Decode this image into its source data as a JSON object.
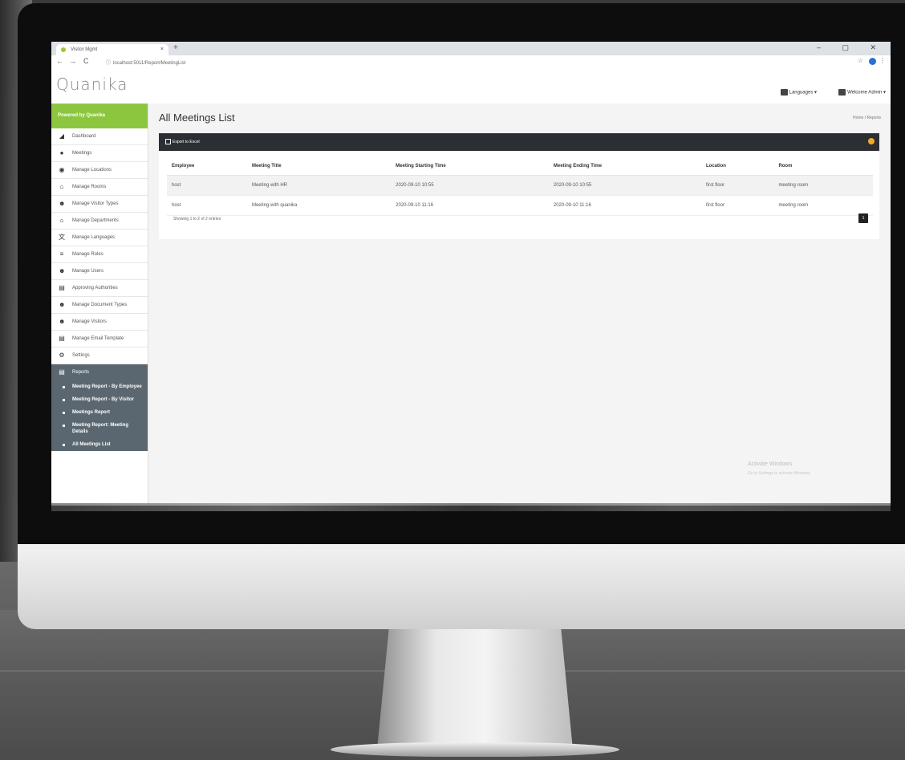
{
  "browser": {
    "tab_title": "Visitor Mgmt",
    "new_tab": "+",
    "close_tab": "×",
    "window_controls": "– ▢ ✕",
    "url": "localhost:5011/Report/MeetingList",
    "back": "←",
    "forward": "→",
    "reload": "C"
  },
  "header": {
    "logo": "Quanika",
    "languages": "Languages ▾",
    "user": "Welcome Admin ▾"
  },
  "sidebar": {
    "powered_by": "Powered by Quanika",
    "items": [
      {
        "label": "Dashboard",
        "icon": "chart-icon",
        "glyph": "◢"
      },
      {
        "label": "Meetings",
        "icon": "handshake-icon",
        "glyph": "●"
      },
      {
        "label": "Manage Locations",
        "icon": "map-marker-icon",
        "glyph": "◉"
      },
      {
        "label": "Manage Rooms",
        "icon": "home-icon",
        "glyph": "⌂"
      },
      {
        "label": "Manage Visitor Types",
        "icon": "users-icon",
        "glyph": "☻"
      },
      {
        "label": "Manage Departments",
        "icon": "building-icon",
        "glyph": "⌂"
      },
      {
        "label": "Manage Languages",
        "icon": "language-icon",
        "glyph": "文"
      },
      {
        "label": "Manage Roles",
        "icon": "list-icon",
        "glyph": "≡"
      },
      {
        "label": "Manage Users",
        "icon": "users-icon",
        "glyph": "☻"
      },
      {
        "label": "Approving Authorities",
        "icon": "id-card-icon",
        "glyph": "▤"
      },
      {
        "label": "Manage Document Types",
        "icon": "users-icon",
        "glyph": "☻"
      },
      {
        "label": "Manage Visitors",
        "icon": "users-icon",
        "glyph": "☻"
      },
      {
        "label": "Manage Email Template",
        "icon": "envelope-icon",
        "glyph": "▤"
      },
      {
        "label": "Settings",
        "icon": "cogs-icon",
        "glyph": "⚙"
      }
    ],
    "reports": {
      "label": "Reports",
      "glyph": "▤"
    },
    "report_items": [
      "Meeting Report - By Employee",
      "Meeting Report - By Visitor",
      "Meetings Report",
      "Meeting Report: Meeting Details",
      "All Meetings List"
    ],
    "collapse": "«"
  },
  "main": {
    "title": "All Meetings List",
    "breadcrumb": "Home / Reports",
    "export": "Export to Excel",
    "columns": [
      "Employee",
      "Meeting Title",
      "Meeting Starting Time",
      "Meeting Ending Time",
      "Location",
      "Room"
    ],
    "rows": [
      [
        "host",
        "Meeting with HR",
        "2020-09-10 10:55",
        "2020-09-10 10:55",
        "first floor",
        "meeting room"
      ],
      [
        "host",
        "Meeting with quanika",
        "2020-09-10 11:16",
        "2020-09-10 11:16",
        "first floor",
        "meeting room"
      ]
    ],
    "showing": "Showing 1 to 2 of 2 entries",
    "page": "1"
  },
  "watermark": {
    "title": "Activate Windows",
    "subtitle": "Go to Settings to activate Windows."
  },
  "colors": {
    "brand_green": "#8cc63f",
    "panel_dark": "#2b2f33",
    "reports_gray": "#5b6770"
  }
}
